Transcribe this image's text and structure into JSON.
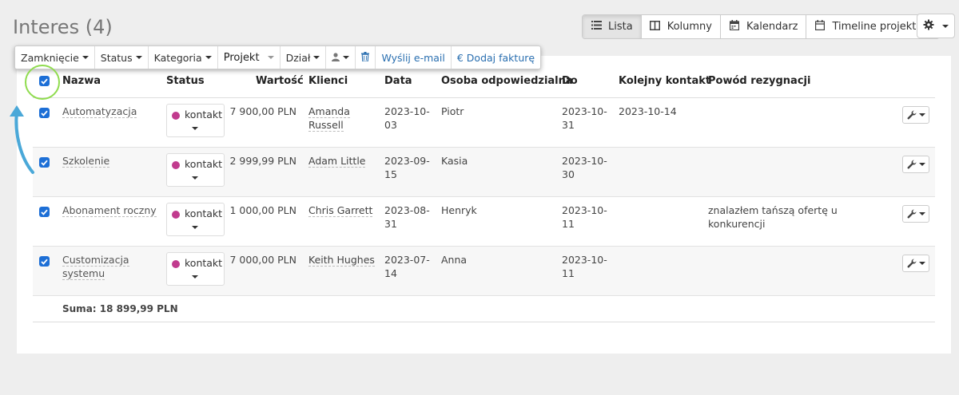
{
  "header": {
    "title": "Interes",
    "count": "(4)"
  },
  "views": [
    {
      "label": "Lista",
      "icon": "list-icon",
      "active": true
    },
    {
      "label": "Kolumny",
      "icon": "columns-icon"
    },
    {
      "label": "Kalendarz",
      "icon": "calendar-icon"
    },
    {
      "label": "Timeline projektów",
      "icon": "timeline-icon"
    }
  ],
  "settings": {
    "icon": "gear-icon"
  },
  "toolbar": {
    "close_label": "Zamknięcie",
    "status_label": "Status",
    "category_label": "Kategoria",
    "project_label": "Projekt",
    "dept_label": "Dział",
    "email_label": "Wyślij e-mail",
    "invoice_label": "€ Dodaj fakturę"
  },
  "columns": {
    "name": "Nazwa",
    "status": "Status",
    "value": "Wartość",
    "clients": "Klienci",
    "date": "Data",
    "owner": "Osoba odpowiedzialna",
    "to": "Do",
    "next_contact": "Kolejny kontakt",
    "reason": "Powód rezygnacji"
  },
  "rows": [
    {
      "name_l1": "Automatyzacja",
      "name_l2": "",
      "status": "kontakt",
      "value": "7 900,00 PLN",
      "client_l1": "Amanda",
      "client_l2": "Russell",
      "date_l1": "2023-10-",
      "date_l2": "03",
      "owner": "Piotr",
      "to_l1": "2023-10-",
      "to_l2": "31",
      "next_contact": "2023-10-14",
      "reason_l1": "",
      "reason_l2": ""
    },
    {
      "name_l1": "Szkolenie",
      "name_l2": "",
      "status": "kontakt",
      "value": "2 999,99 PLN",
      "client_l1": "Adam Little",
      "client_l2": "",
      "date_l1": "2023-09-",
      "date_l2": "15",
      "owner": "Kasia",
      "to_l1": "2023-10-",
      "to_l2": "30",
      "next_contact": "",
      "reason_l1": "",
      "reason_l2": ""
    },
    {
      "name_l1": "Abonament roczny",
      "name_l2": "",
      "status": "kontakt",
      "value": "1 000,00 PLN",
      "client_l1": "Chris Garrett",
      "client_l2": "",
      "date_l1": "2023-08-",
      "date_l2": "31",
      "owner": "Henryk",
      "to_l1": "2023-10-",
      "to_l2": "11",
      "next_contact": "",
      "reason_l1": "znalazłem tańszą ofertę u",
      "reason_l2": "konkurencji"
    },
    {
      "name_l1": "Customizacja",
      "name_l2": "systemu",
      "status": "kontakt",
      "value": "7 000,00 PLN",
      "client_l1": "Keith Hughes",
      "client_l2": "",
      "date_l1": "2023-07-",
      "date_l2": "14",
      "owner": "Anna",
      "to_l1": "2023-10-",
      "to_l2": "11",
      "next_contact": "",
      "reason_l1": "",
      "reason_l2": ""
    }
  ],
  "summary": {
    "total": "Suma: 18 899,99 PLN"
  },
  "colors": {
    "status_dot": "#c13b8e",
    "checkbox": "#1d6fd6",
    "highlight": "#8fdc4e",
    "arrow": "#4aa8d8",
    "link": "#2a6fb0"
  }
}
